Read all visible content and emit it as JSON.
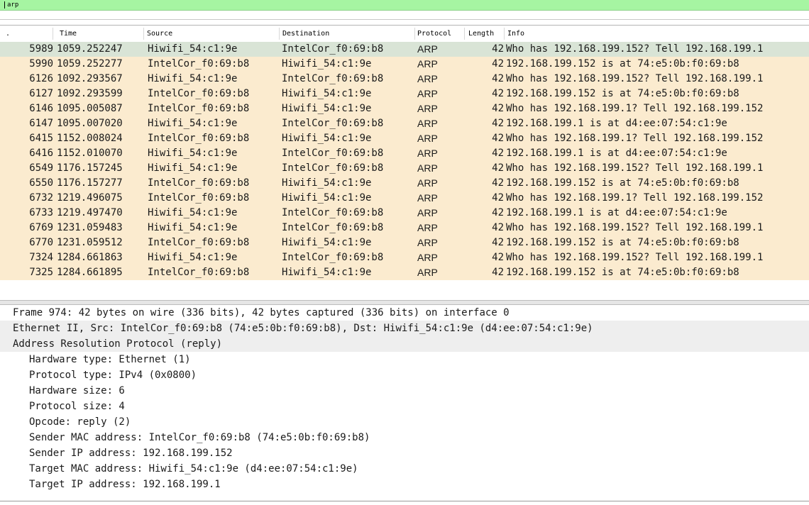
{
  "filter": {
    "value": "arp"
  },
  "columns": {
    "no": ".",
    "time": "Time",
    "source": "Source",
    "destination": "Destination",
    "protocol": "Protocol",
    "length": "Length",
    "info": "Info"
  },
  "packets": [
    {
      "no": "5989",
      "time": "1059.252247",
      "src": "Hiwifi_54:c1:9e",
      "dst": "IntelCor_f0:69:b8",
      "proto": "ARP",
      "len": "42",
      "info": "Who has 192.168.199.152? Tell 192.168.199.1",
      "selected": true
    },
    {
      "no": "5990",
      "time": "1059.252277",
      "src": "IntelCor_f0:69:b8",
      "dst": "Hiwifi_54:c1:9e",
      "proto": "ARP",
      "len": "42",
      "info": "192.168.199.152 is at 74:e5:0b:f0:69:b8"
    },
    {
      "no": "6126",
      "time": "1092.293567",
      "src": "Hiwifi_54:c1:9e",
      "dst": "IntelCor_f0:69:b8",
      "proto": "ARP",
      "len": "42",
      "info": "Who has 192.168.199.152? Tell 192.168.199.1"
    },
    {
      "no": "6127",
      "time": "1092.293599",
      "src": "IntelCor_f0:69:b8",
      "dst": "Hiwifi_54:c1:9e",
      "proto": "ARP",
      "len": "42",
      "info": "192.168.199.152 is at 74:e5:0b:f0:69:b8"
    },
    {
      "no": "6146",
      "time": "1095.005087",
      "src": "IntelCor_f0:69:b8",
      "dst": "Hiwifi_54:c1:9e",
      "proto": "ARP",
      "len": "42",
      "info": "Who has 192.168.199.1? Tell 192.168.199.152"
    },
    {
      "no": "6147",
      "time": "1095.007020",
      "src": "Hiwifi_54:c1:9e",
      "dst": "IntelCor_f0:69:b8",
      "proto": "ARP",
      "len": "42",
      "info": "192.168.199.1 is at d4:ee:07:54:c1:9e"
    },
    {
      "no": "6415",
      "time": "1152.008024",
      "src": "IntelCor_f0:69:b8",
      "dst": "Hiwifi_54:c1:9e",
      "proto": "ARP",
      "len": "42",
      "info": "Who has 192.168.199.1? Tell 192.168.199.152"
    },
    {
      "no": "6416",
      "time": "1152.010070",
      "src": "Hiwifi_54:c1:9e",
      "dst": "IntelCor_f0:69:b8",
      "proto": "ARP",
      "len": "42",
      "info": "192.168.199.1 is at d4:ee:07:54:c1:9e"
    },
    {
      "no": "6549",
      "time": "1176.157245",
      "src": "Hiwifi_54:c1:9e",
      "dst": "IntelCor_f0:69:b8",
      "proto": "ARP",
      "len": "42",
      "info": "Who has 192.168.199.152? Tell 192.168.199.1"
    },
    {
      "no": "6550",
      "time": "1176.157277",
      "src": "IntelCor_f0:69:b8",
      "dst": "Hiwifi_54:c1:9e",
      "proto": "ARP",
      "len": "42",
      "info": "192.168.199.152 is at 74:e5:0b:f0:69:b8"
    },
    {
      "no": "6732",
      "time": "1219.496075",
      "src": "IntelCor_f0:69:b8",
      "dst": "Hiwifi_54:c1:9e",
      "proto": "ARP",
      "len": "42",
      "info": "Who has 192.168.199.1? Tell 192.168.199.152"
    },
    {
      "no": "6733",
      "time": "1219.497470",
      "src": "Hiwifi_54:c1:9e",
      "dst": "IntelCor_f0:69:b8",
      "proto": "ARP",
      "len": "42",
      "info": "192.168.199.1 is at d4:ee:07:54:c1:9e"
    },
    {
      "no": "6769",
      "time": "1231.059483",
      "src": "Hiwifi_54:c1:9e",
      "dst": "IntelCor_f0:69:b8",
      "proto": "ARP",
      "len": "42",
      "info": "Who has 192.168.199.152? Tell 192.168.199.1"
    },
    {
      "no": "6770",
      "time": "1231.059512",
      "src": "IntelCor_f0:69:b8",
      "dst": "Hiwifi_54:c1:9e",
      "proto": "ARP",
      "len": "42",
      "info": "192.168.199.152 is at 74:e5:0b:f0:69:b8"
    },
    {
      "no": "7324",
      "time": "1284.661863",
      "src": "Hiwifi_54:c1:9e",
      "dst": "IntelCor_f0:69:b8",
      "proto": "ARP",
      "len": "42",
      "info": "Who has 192.168.199.152? Tell 192.168.199.1"
    },
    {
      "no": "7325",
      "time": "1284.661895",
      "src": "IntelCor_f0:69:b8",
      "dst": "Hiwifi_54:c1:9e",
      "proto": "ARP",
      "len": "42",
      "info": "192.168.199.152 is at 74:e5:0b:f0:69:b8"
    }
  ],
  "details": {
    "frame": "Frame 974: 42 bytes on wire (336 bits), 42 bytes captured (336 bits) on interface 0",
    "ethernet": "Ethernet II, Src: IntelCor_f0:69:b8 (74:e5:0b:f0:69:b8), Dst: Hiwifi_54:c1:9e (d4:ee:07:54:c1:9e)",
    "arp": "Address Resolution Protocol (reply)",
    "arp_fields": [
      "Hardware type: Ethernet (1)",
      "Protocol type: IPv4 (0x0800)",
      "Hardware size: 6",
      "Protocol size: 4",
      "Opcode: reply (2)",
      "Sender MAC address: IntelCor_f0:69:b8 (74:e5:0b:f0:69:b8)",
      "Sender IP address: 192.168.199.152",
      "Target MAC address: Hiwifi_54:c1:9e (d4:ee:07:54:c1:9e)",
      "Target IP address: 192.168.199.1"
    ]
  },
  "colors": {
    "filter_valid_bg": "#a6f5a2",
    "row_arp_bg": "#fbebcf",
    "row_selected_bg": "#d9e4d6"
  }
}
